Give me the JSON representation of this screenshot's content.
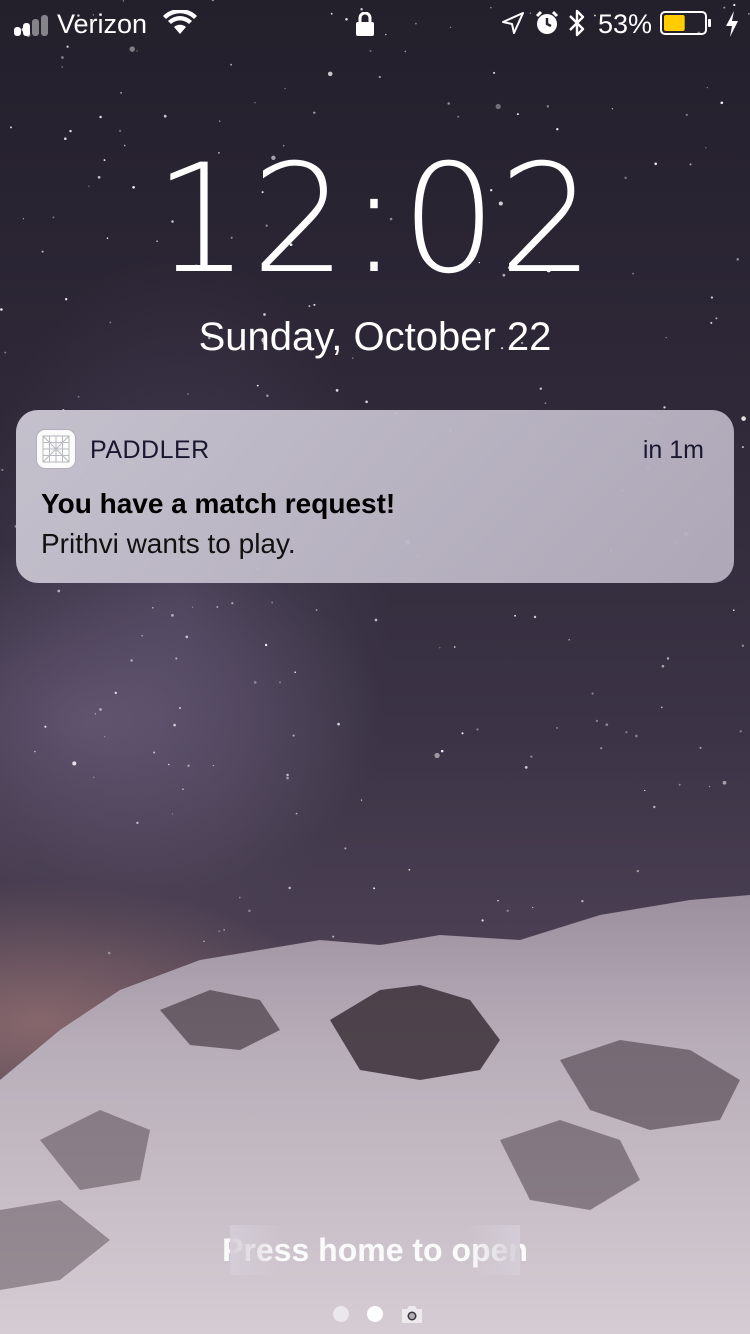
{
  "status_bar": {
    "carrier": "Verizon",
    "signal_bars": 4,
    "signal_bars_filled": 2,
    "battery_percent": "53%",
    "battery_level": 0.53,
    "battery_color": "#ffcc00",
    "icons": [
      "signal-icon",
      "wifi-icon",
      "lock-icon",
      "location-icon",
      "alarm-icon",
      "bluetooth-icon",
      "battery-icon",
      "charging-bolt-icon"
    ]
  },
  "lock_screen": {
    "time": "12:02",
    "date": "Sunday, October 22"
  },
  "notification": {
    "app_icon": "paddler-app-icon",
    "app_name": "PADDLER",
    "time": "in 1m",
    "title": "You have a match request!",
    "body": "Prithvi wants to play."
  },
  "bottom": {
    "unlock_hint": "Press home to open",
    "page_dots": 2,
    "active_page": 1,
    "camera_icon": "camera-icon"
  }
}
